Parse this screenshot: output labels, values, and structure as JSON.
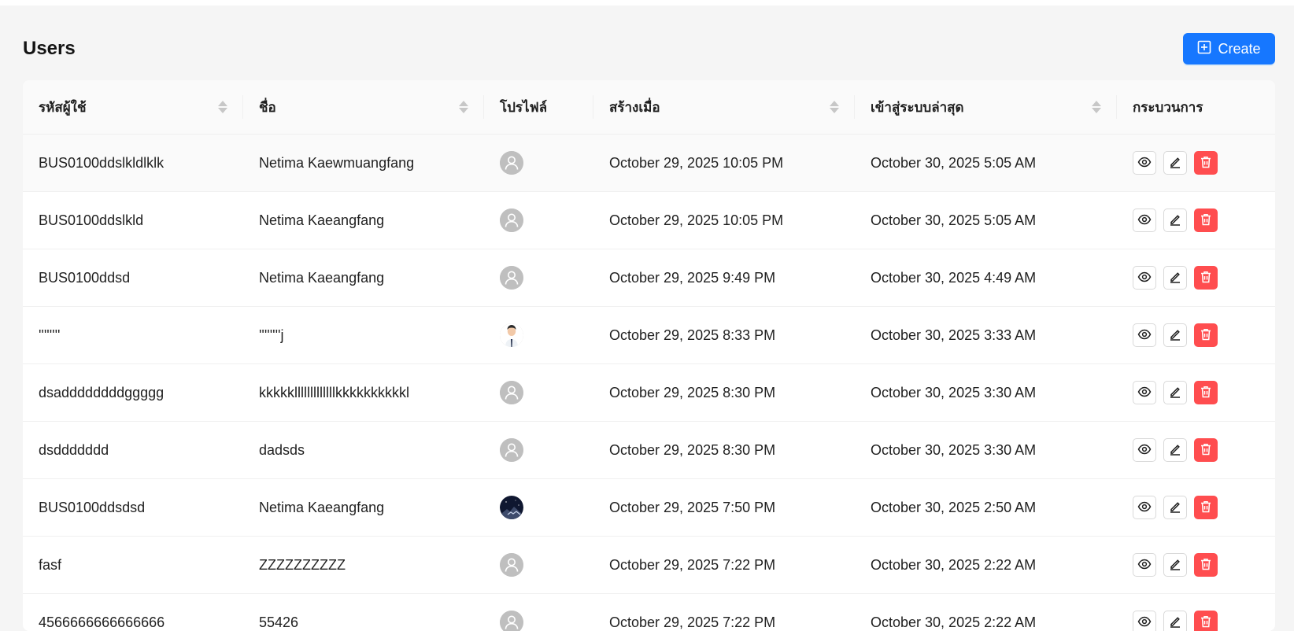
{
  "page": {
    "title": "Users",
    "create_label": "Create"
  },
  "colors": {
    "accent": "#1677ff",
    "danger": "#ff4d4f",
    "avatar_bg": "#bfbfbf"
  },
  "table": {
    "columns": [
      {
        "label": "รหัสผู้ใช้",
        "sortable": true
      },
      {
        "label": "ชื่อ",
        "sortable": true
      },
      {
        "label": "โปรไฟล์",
        "sortable": false
      },
      {
        "label": "สร้างเมื่อ",
        "sortable": true
      },
      {
        "label": "เข้าสู่ระบบล่าสุด",
        "sortable": true
      },
      {
        "label": "กระบวนการ",
        "sortable": false
      }
    ],
    "rows": [
      {
        "user_id": "BUS0100ddslkldlklk",
        "name": "Netima Kaewmuangfang",
        "avatar": "default-user-icon",
        "created": "October 29, 2025 10:05 PM",
        "last_login": "October 30, 2025 5:05 AM"
      },
      {
        "user_id": "BUS0100ddslkld",
        "name": "Netima Kaeangfang",
        "avatar": "default-user-icon",
        "created": "October 29, 2025 10:05 PM",
        "last_login": "October 30, 2025 5:05 AM"
      },
      {
        "user_id": "BUS0100ddsd",
        "name": "Netima Kaeangfang",
        "avatar": "default-user-icon",
        "created": "October 29, 2025 9:49 PM",
        "last_login": "October 30, 2025 4:49 AM"
      },
      {
        "user_id": "''''''''",
        "name": "''''''''j",
        "avatar": "person-photo",
        "created": "October 29, 2025 8:33 PM",
        "last_login": "October 30, 2025 3:33 AM"
      },
      {
        "user_id": "dsaddddddddggggg",
        "name": "kkkkklllllllllllllkkkkkkkkkkl",
        "avatar": "default-user-icon",
        "created": "October 29, 2025 8:30 PM",
        "last_login": "October 30, 2025 3:30 AM"
      },
      {
        "user_id": "dsddddddd",
        "name": "dadsds",
        "avatar": "default-user-icon",
        "created": "October 29, 2025 8:30 PM",
        "last_login": "October 30, 2025 3:30 AM"
      },
      {
        "user_id": "BUS0100ddsdsd",
        "name": "Netima Kaeangfang",
        "avatar": "night-sky-photo",
        "created": "October 29, 2025 7:50 PM",
        "last_login": "October 30, 2025 2:50 AM"
      },
      {
        "user_id": "fasf",
        "name": "ZZZZZZZZZZ",
        "avatar": "default-user-icon",
        "created": "October 29, 2025 7:22 PM",
        "last_login": "October 30, 2025 2:22 AM"
      },
      {
        "user_id": "4566666666666666",
        "name": "55426",
        "avatar": "default-user-icon",
        "created": "October 29, 2025 7:22 PM",
        "last_login": "October 30, 2025 2:22 AM"
      }
    ]
  },
  "icons": {
    "view": "eye-icon",
    "edit": "edit-icon",
    "delete": "trash-icon",
    "create": "plus-square-icon"
  }
}
